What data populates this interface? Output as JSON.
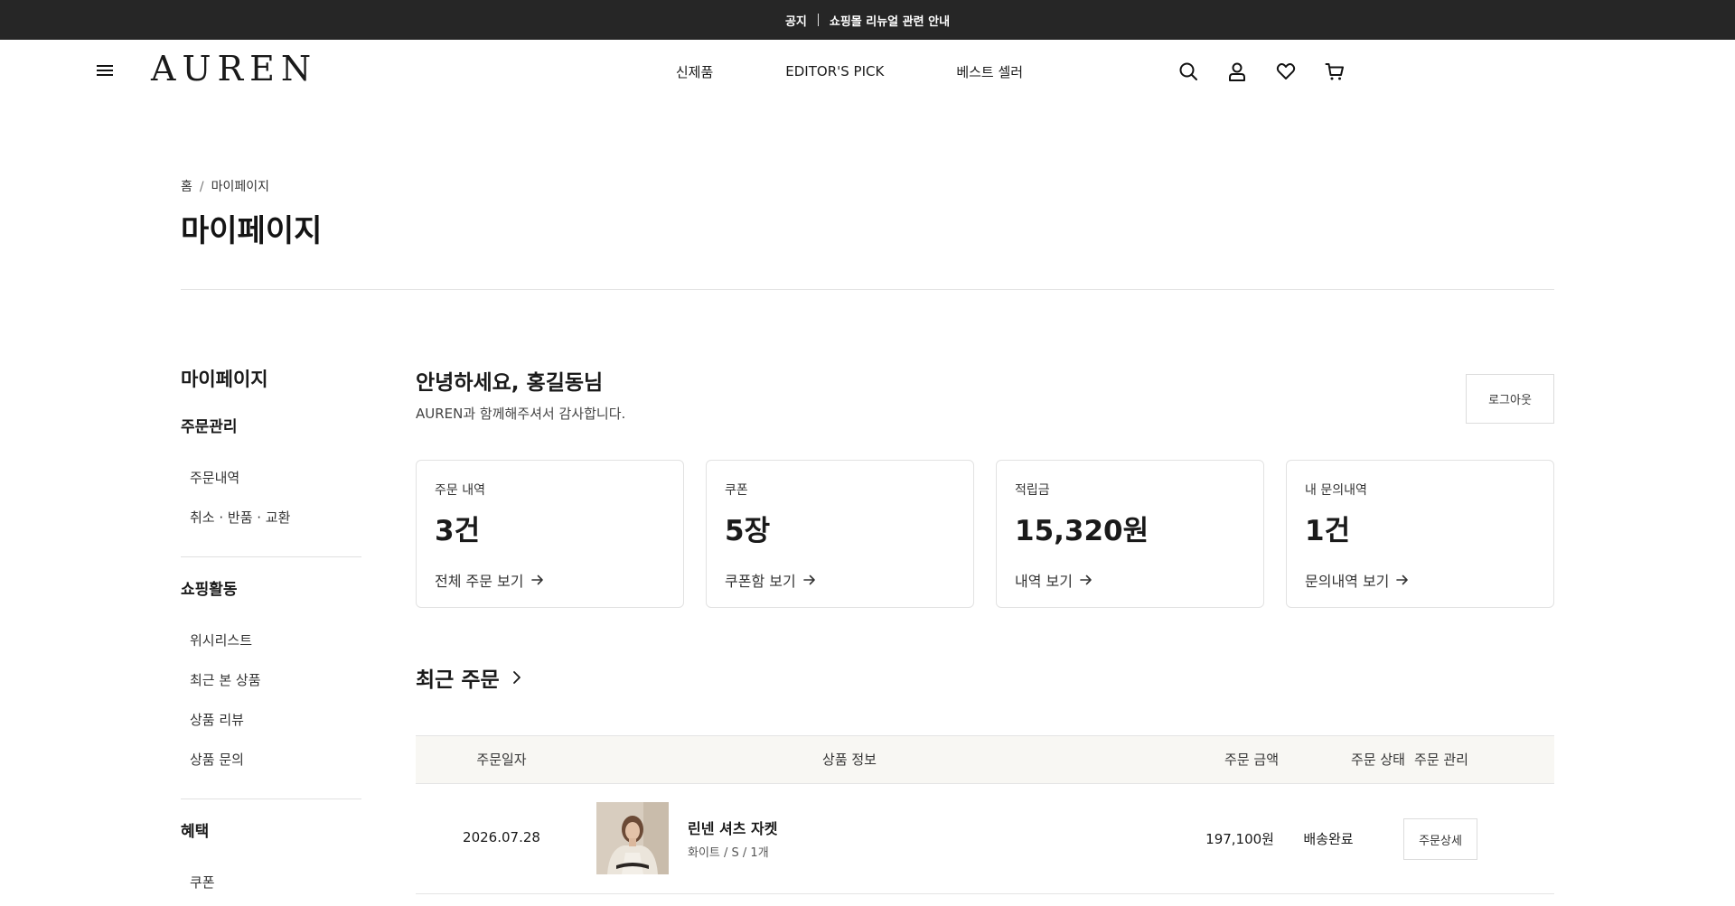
{
  "notice": {
    "label": "공지",
    "text": "쇼핑몰 리뉴얼 관련 안내"
  },
  "header": {
    "logo": "AUREN",
    "nav": [
      "신제품",
      "EDITOR'S PICK",
      "베스트 셀러"
    ],
    "icons": [
      "search-icon",
      "user-icon",
      "heart-icon",
      "cart-icon"
    ]
  },
  "breadcrumb": {
    "home": "홈",
    "separator": "/",
    "current": "마이페이지"
  },
  "page_title": "마이페이지",
  "sidebar": {
    "title": "마이페이지",
    "sections": [
      {
        "title": "주문관리",
        "items": [
          "주문내역",
          "취소 · 반품 · 교환"
        ]
      },
      {
        "title": "쇼핑활동",
        "items": [
          "위시리스트",
          "최근 본 상품",
          "상품 리뷰",
          "상품 문의"
        ]
      },
      {
        "title": "혜택",
        "items": [
          "쿠폰"
        ]
      }
    ]
  },
  "greeting": {
    "title": "안녕하세요, 홍길동님",
    "subtitle": "AUREN과 함께해주셔서 감사합니다.",
    "logout": "로그아웃"
  },
  "summary_cards": [
    {
      "label": "주문 내역",
      "value": "3건",
      "link": "전체 주문 보기"
    },
    {
      "label": "쿠폰",
      "value": "5장",
      "link": "쿠폰함 보기"
    },
    {
      "label": "적립금",
      "value": "15,320원",
      "link": "내역 보기"
    },
    {
      "label": "내 문의내역",
      "value": "1건",
      "link": "문의내역 보기"
    }
  ],
  "recent_orders": {
    "title": "최근 주문",
    "columns": [
      "주문일자",
      "상품 정보",
      "주문 금액",
      "주문 상태",
      "주문 관리"
    ],
    "rows": [
      {
        "date": "2026.07.28",
        "product_name": "린넨 셔츠 자켓",
        "product_option": "화이트 / S / 1개",
        "amount": "197,100원",
        "status": "배송완료",
        "action": "주문상세"
      }
    ]
  },
  "colors": {
    "notice_bg": "#262626",
    "table_head_bg": "#f8f7f3",
    "border": "#e2e2e2"
  }
}
